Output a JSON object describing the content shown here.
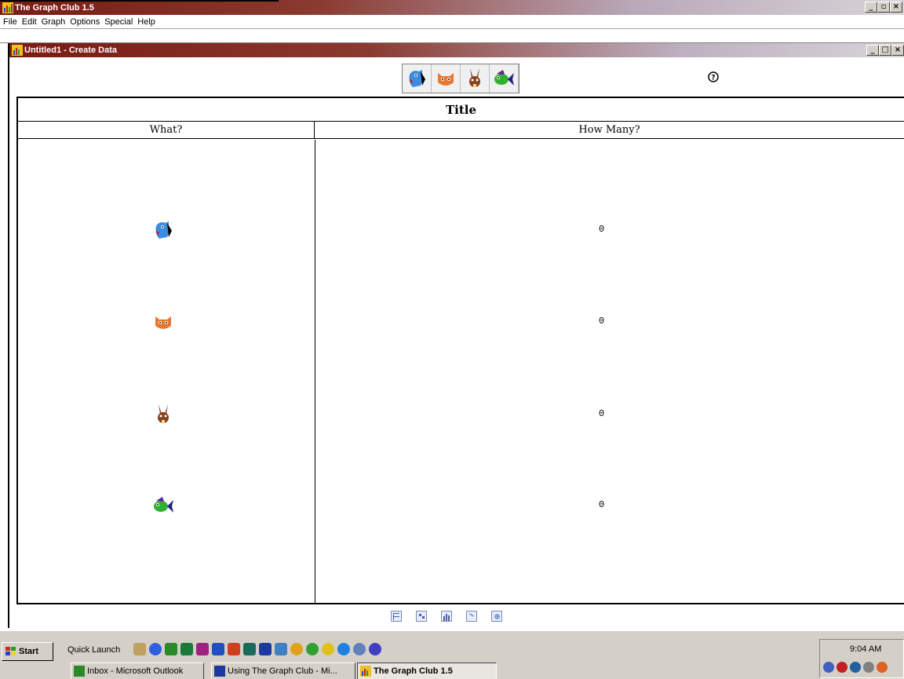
{
  "app": {
    "title": "The Graph Club 1.5",
    "window_buttons": [
      "_",
      "▫",
      "×"
    ]
  },
  "menu": [
    "File",
    "Edit",
    "Graph",
    "Options",
    "Special",
    "Help"
  ],
  "child_window": {
    "title": "Untitled1 - Create Data",
    "window_buttons": [
      "_",
      "□",
      "×"
    ]
  },
  "animal_toolbar": [
    "dog",
    "cat",
    "rabbit",
    "fish"
  ],
  "table": {
    "title": "Title",
    "col_what": "What?",
    "col_how_many": "How Many?",
    "rows": [
      {
        "animal": "dog",
        "count": "0"
      },
      {
        "animal": "cat",
        "count": "0"
      },
      {
        "animal": "rabbit",
        "count": "0"
      },
      {
        "animal": "fish",
        "count": "0"
      }
    ]
  },
  "graph_tools": [
    "table-view-icon",
    "picture-graph-icon",
    "bar-graph-icon",
    "line-graph-icon",
    "circle-graph-icon"
  ],
  "taskbar": {
    "start_label": "Start",
    "quick_launch_label": "Quick Launch",
    "tasks": [
      {
        "label": "Inbox - Microsoft Outlook",
        "active": false
      },
      {
        "label": "Using The Graph Club - Mi...",
        "active": false
      },
      {
        "label": "The Graph Club 1.5",
        "active": true
      }
    ],
    "clock": "9:04 AM"
  },
  "colors": {
    "titlebar_active": "#7a1a14",
    "taskbar": "#d4d0c8"
  }
}
